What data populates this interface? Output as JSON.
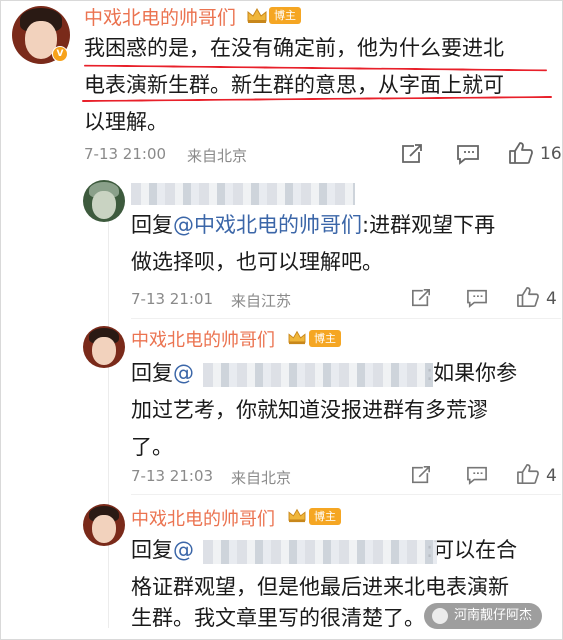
{
  "main_comment": {
    "username": "中戏北电的帅哥们",
    "badge": "博主",
    "text": "我困惑的是，在没有确定前，他为什么要进北电表演新生群。新生群的意思，从字面上就可以理解。",
    "line1": "我困惑的是，在没有确定前，他为什么要进北",
    "line2": "电表演新生群。新生群的意思，从字面上就可",
    "line3": "以理解。",
    "time": "7-13 21:00",
    "location": "来自北京",
    "like_count": "16",
    "verified_mark": "V"
  },
  "replies": [
    {
      "username_masked": true,
      "reply_prefix": "回复",
      "mention": "@中戏北电的帅哥们",
      "line1_rest": ":进群观望下再",
      "line2": "做选择呗，也可以理解吧。",
      "time": "7-13 21:01",
      "location": "来自江苏",
      "like_count": "4"
    },
    {
      "username": "中戏北电的帅哥们",
      "badge": "博主",
      "reply_prefix": "回复",
      "mention": "@",
      "line1_rest": ":如果你参",
      "line2": "加过艺考，你就知道没报进群有多荒谬",
      "line3": "了。",
      "time": "7-13 21:03",
      "location": "来自北京",
      "like_count": "4"
    },
    {
      "username": "中戏北电的帅哥们",
      "badge": "博主",
      "reply_prefix": "回复",
      "mention": "@",
      "line1_rest": ":可以在合",
      "line2": "格证群观望，但是他最后进来北电表演新",
      "line3": "生群。我文章里写的很清楚了。"
    }
  ],
  "watermark": "河南靓仔阿杰",
  "colors": {
    "username": "#eb7350",
    "mention": "#3b66a8",
    "highlight_line": "#e8202a",
    "badge": "#f5a623"
  },
  "icons": [
    "share-icon",
    "comment-icon",
    "like-icon",
    "crown-icon"
  ]
}
